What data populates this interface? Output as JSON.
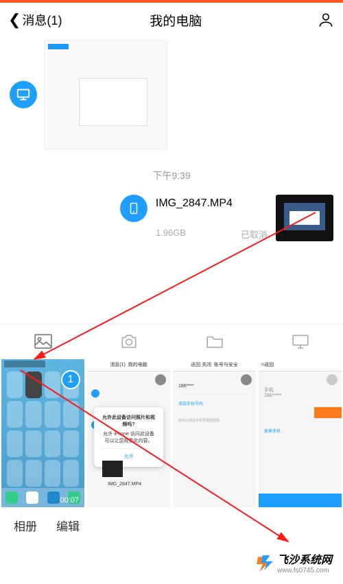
{
  "header": {
    "back_label": "消息(1)",
    "title": "我的电脑"
  },
  "chat": {
    "timestamp": "下午9:39",
    "file": {
      "name": "IMG_2847.MP4",
      "size": "1.96GB",
      "status": "已取消"
    }
  },
  "thumb1": {
    "badge": "1",
    "time": "00:07"
  },
  "thumb2": {
    "header": "我的电脑",
    "header_left": "消息(1)",
    "dialog_title": "允许此设备访问照片和视频吗?",
    "dialog_body": "允许 iPhone 访问此设备可以让您观看此内容。",
    "dialog_btn": "允许",
    "file_name": "IMG_2847.MP4"
  },
  "thumb3": {
    "header_left": "返回 关闭",
    "header_title": "账号与安全"
  },
  "bottom": {
    "album": "相册",
    "edit": "编辑"
  },
  "watermark": {
    "name": "飞沙系统网",
    "url": "www.fs0745.com"
  },
  "icons": {
    "photo": "photo-icon",
    "camera": "camera-icon",
    "folder": "folder-icon",
    "monitor": "monitor-icon"
  }
}
